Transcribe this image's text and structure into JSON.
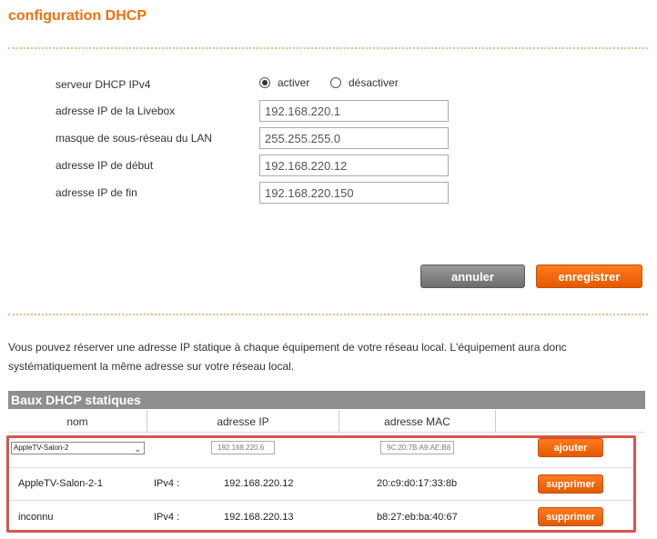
{
  "page": {
    "title": "configuration DHCP"
  },
  "dhcp": {
    "server_label": "serveur DHCP IPv4",
    "radio_enable_label": "activer",
    "radio_disable_label": "désactiver",
    "selected": "activer",
    "fields": [
      {
        "label": "adresse IP de la Livebox",
        "value": "192.168.220.1"
      },
      {
        "label": "masque de sous-réseau du LAN",
        "value": "255.255.255.0"
      },
      {
        "label": "adresse IP de début",
        "value": "192.168.220.12"
      },
      {
        "label": "adresse IP de fin",
        "value": "192.168.220.150"
      }
    ]
  },
  "actions": {
    "cancel_label": "annuler",
    "save_label": "enregistrer"
  },
  "info_text": "Vous pouvez réserver une adresse IP statique à chaque équipement de votre réseau local. L'équipement aura donc systématiquement la même adresse sur votre réseau local.",
  "static_leases": {
    "title": "Baux DHCP statiques",
    "columns": [
      "nom",
      "adresse IP",
      "adresse MAC",
      ""
    ],
    "new_entry": {
      "device_selected": "AppleTV-Salon-2",
      "ip_placeholder": "192.168.220.6",
      "mac_placeholder": "9C:20:7B:A9:AE:B8",
      "add_label": "ajouter"
    },
    "rows": [
      {
        "name": "AppleTV-Salon-2-1",
        "proto": "IPv4 :",
        "ip": "192.168.220.12",
        "mac": "20:c9:d0:17:33:8b",
        "action": "supprimer"
      },
      {
        "name": "inconnu",
        "proto": "IPv4 :",
        "ip": "192.168.220.13",
        "mac": "b8:27:eb:ba:40:67",
        "action": "supprimer"
      }
    ]
  },
  "colors": {
    "accent": "#f26f0e",
    "button_gray": "#7a7a7a",
    "highlight_frame": "#d9534f"
  }
}
